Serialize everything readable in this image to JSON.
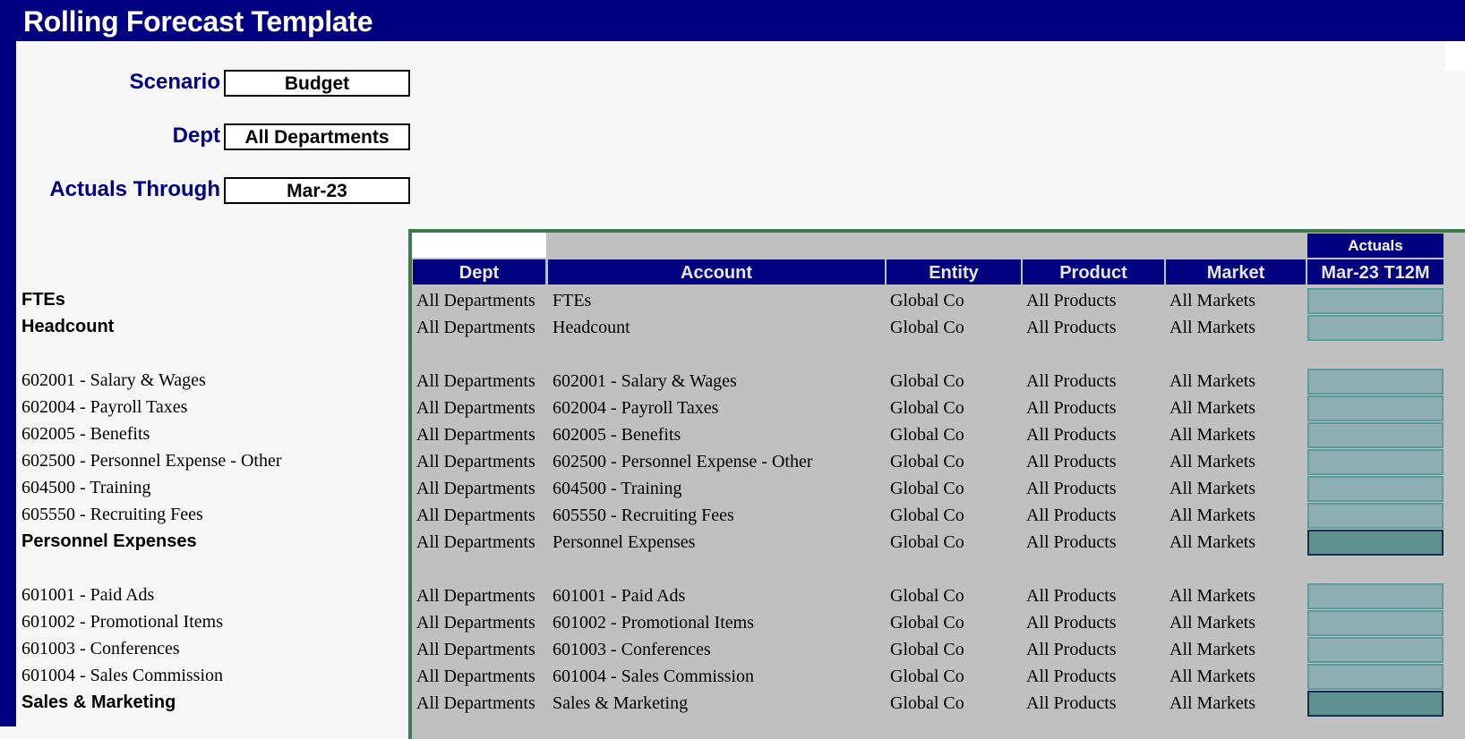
{
  "title": "Rolling Forecast Template",
  "params": [
    {
      "label": "Scenario",
      "value": "Budget"
    },
    {
      "label": "Dept",
      "value": "All Departments"
    },
    {
      "label": "Actuals Through",
      "value": "Mar-23"
    }
  ],
  "table": {
    "group_header": "Actuals",
    "columns": [
      "Dept",
      "Account",
      "Entity",
      "Product",
      "Market",
      "Mar-23 T12M"
    ],
    "rows": [
      {
        "label": "FTEs",
        "bold": true,
        "dept": "All Departments",
        "account": "FTEs",
        "entity": "Global Co",
        "product": "All Products",
        "market": "All Markets",
        "kind": "input"
      },
      {
        "label": "Headcount",
        "bold": true,
        "dept": "All Departments",
        "account": "Headcount",
        "entity": "Global Co",
        "product": "All Products",
        "market": "All Markets",
        "kind": "input"
      },
      {
        "spacer": true
      },
      {
        "label": "602001 - Salary & Wages",
        "bold": false,
        "dept": "All Departments",
        "account": "602001 - Salary & Wages",
        "entity": "Global Co",
        "product": "All Products",
        "market": "All Markets",
        "kind": "input"
      },
      {
        "label": "602004 - Payroll Taxes",
        "bold": false,
        "dept": "All Departments",
        "account": "602004 - Payroll Taxes",
        "entity": "Global Co",
        "product": "All Products",
        "market": "All Markets",
        "kind": "input"
      },
      {
        "label": "602005 - Benefits",
        "bold": false,
        "dept": "All Departments",
        "account": "602005 - Benefits",
        "entity": "Global Co",
        "product": "All Products",
        "market": "All Markets",
        "kind": "input"
      },
      {
        "label": "602500 - Personnel Expense - Other",
        "bold": false,
        "dept": "All Departments",
        "account": "602500 - Personnel Expense - Other",
        "entity": "Global Co",
        "product": "All Products",
        "market": "All Markets",
        "kind": "input"
      },
      {
        "label": "604500 - Training",
        "bold": false,
        "dept": "All Departments",
        "account": "604500 - Training",
        "entity": "Global Co",
        "product": "All Products",
        "market": "All Markets",
        "kind": "input"
      },
      {
        "label": "605550 - Recruiting Fees",
        "bold": false,
        "dept": "All Departments",
        "account": "605550 - Recruiting Fees",
        "entity": "Global Co",
        "product": "All Products",
        "market": "All Markets",
        "kind": "input"
      },
      {
        "label": "Personnel Expenses",
        "bold": true,
        "dept": "All Departments",
        "account": "Personnel Expenses",
        "entity": "Global Co",
        "product": "All Products",
        "market": "All Markets",
        "kind": "total"
      },
      {
        "spacer": true
      },
      {
        "label": "601001 - Paid Ads",
        "bold": false,
        "dept": "All Departments",
        "account": "601001 - Paid Ads",
        "entity": "Global Co",
        "product": "All Products",
        "market": "All Markets",
        "kind": "input"
      },
      {
        "label": "601002 - Promotional Items",
        "bold": false,
        "dept": "All Departments",
        "account": "601002 - Promotional Items",
        "entity": "Global Co",
        "product": "All Products",
        "market": "All Markets",
        "kind": "input"
      },
      {
        "label": "601003 - Conferences",
        "bold": false,
        "dept": "All Departments",
        "account": "601003 - Conferences",
        "entity": "Global Co",
        "product": "All Products",
        "market": "All Markets",
        "kind": "input"
      },
      {
        "label": "601004 - Sales Commission",
        "bold": false,
        "dept": "All Departments",
        "account": "601004 - Sales Commission",
        "entity": "Global Co",
        "product": "All Products",
        "market": "All Markets",
        "kind": "input"
      },
      {
        "label": "Sales & Marketing",
        "bold": true,
        "dept": "All Departments",
        "account": "Sales & Marketing",
        "entity": "Global Co",
        "product": "All Products",
        "market": "All Markets",
        "kind": "total"
      }
    ]
  }
}
